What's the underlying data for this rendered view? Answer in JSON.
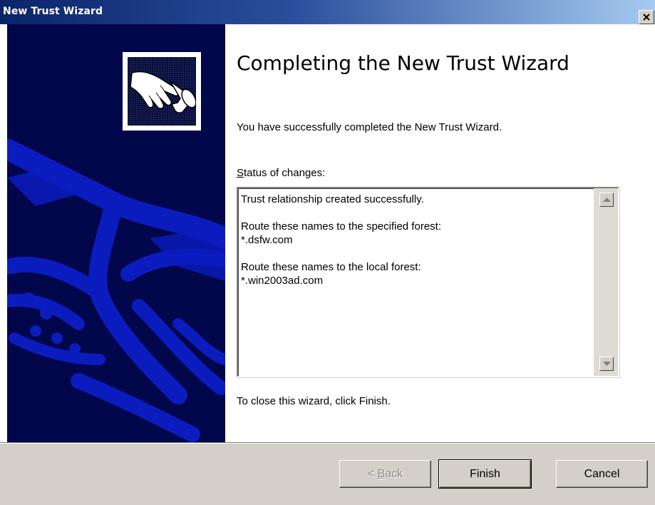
{
  "window": {
    "title": "New Trust Wizard",
    "close_icon": "close-icon"
  },
  "left_panel": {
    "icon": "handshake-icon",
    "background_color": "#02064a",
    "art_color": "#0b1cbf"
  },
  "content": {
    "heading": "Completing the New Trust Wizard",
    "subtitle": "You have successfully completed the New Trust Wizard.",
    "status_label_prefix": "",
    "status_label_accel": "S",
    "status_label_rest": "tatus of changes:",
    "status_text": "Trust relationship created successfully.\n\nRoute these names to the specified forest:\n*.dsfw.com\n\nRoute these names to the local forest:\n*.win2003ad.com",
    "close_hint": "To close this wizard, click Finish."
  },
  "buttons": {
    "back_prefix": "< ",
    "back_accel": "B",
    "back_rest": "ack",
    "back_enabled": false,
    "finish": "Finish",
    "cancel": "Cancel"
  }
}
